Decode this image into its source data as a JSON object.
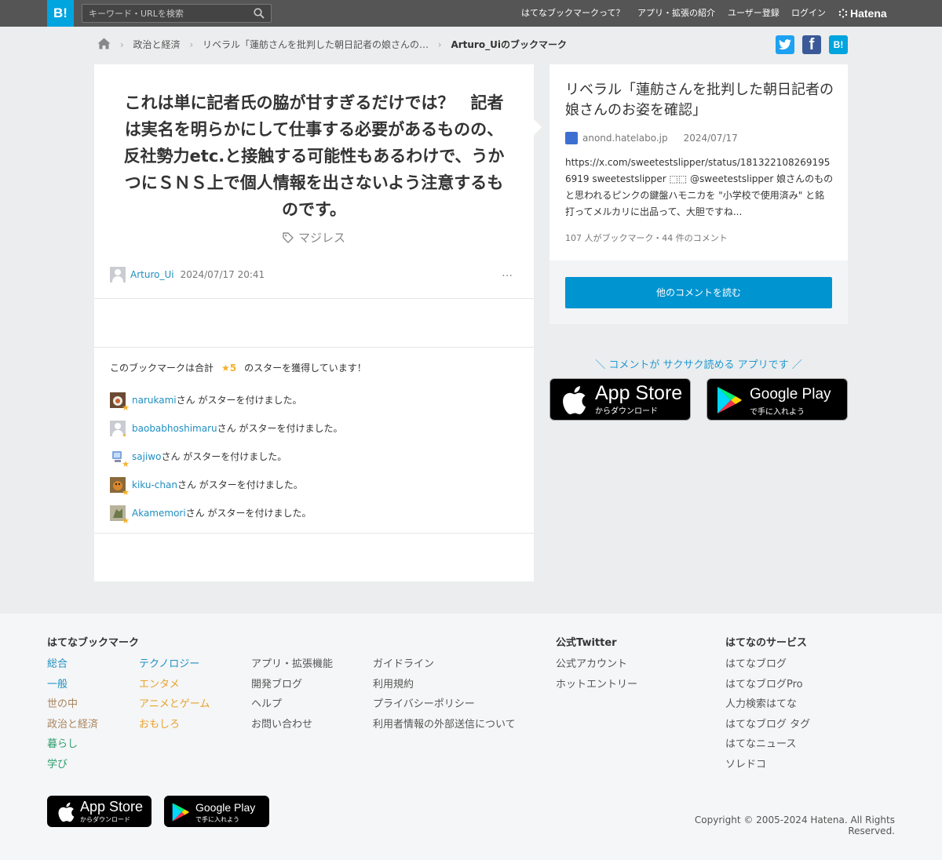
{
  "header": {
    "logo": "B!",
    "search_placeholder": "キーワード・URLを検索",
    "nav": [
      "はてなブックマークって？",
      "アプリ・拡張の紹介",
      "ユーザー登録",
      "ログイン"
    ],
    "brand": "Hatena"
  },
  "breadcrumb": {
    "items": [
      "政治と経済",
      "リベラル「蓮舫さんを批判した朝日記者の娘さんの…"
    ],
    "current": "Arturo_Uiのブックマーク"
  },
  "share": {
    "facebook": "f",
    "hatena": "B!"
  },
  "bookmark": {
    "comment": "これは単に記者氏の脇が甘すぎるだけでは？　記者は実名を明らかにして仕事する必要があるものの、反社勢力etc.と接触する可能性もあるわけで、うかつにＳＮＳ上で個人情報を出さないよう注意するものです。",
    "tag": "マジレス",
    "user": "Arturo_Ui",
    "date": "2024/07/17 20:41",
    "more": "…"
  },
  "stars": {
    "title_before": "このブックマークは合計",
    "count": "★5",
    "title_after": "のスターを獲得しています！",
    "suffix": "さん がスターを付けました。",
    "users": [
      "narukami",
      "baobabhoshimaru",
      "sajiwo",
      "kiku-chan",
      "Akamemori"
    ]
  },
  "entry": {
    "title": "リベラル「蓮舫さんを批判した朝日記者の娘さんのお姿を確認」",
    "site": "anond.hatelabo.jp",
    "date": "2024/07/17",
    "summary": "https://x.com/sweetestslipper/status/1813221082691956919 sweetestslipper ⬚⬚ @sweetestslipper 娘さんのものと思われるピンクの鍵盤ハモニカを \"小学校で使用済み\" と銘打ってメルカリに出品って、大胆ですね...",
    "meta": "107 人がブックマーク・44 件のコメント",
    "more_button": "他のコメントを読む"
  },
  "app_promo": {
    "text": "＼ コメントが サクサク読める アプリです ／",
    "appstore_big": "App Store",
    "appstore_small": "からダウンロード",
    "googleplay_big": "Google Play",
    "googleplay_small": "で手に入れよう"
  },
  "footer": {
    "col1_title": "はてなブックマーク",
    "cat_a": [
      "総合",
      "一般",
      "世の中",
      "政治と経済",
      "暮らし",
      "学び"
    ],
    "cat_b": [
      "テクノロジー",
      "エンタメ",
      "アニメとゲーム",
      "おもしろ"
    ],
    "links_a": [
      "アプリ・拡張機能",
      "開発ブログ",
      "ヘルプ",
      "お問い合わせ"
    ],
    "links_b": [
      "ガイドライン",
      "利用規約",
      "プライバシーポリシー",
      "利用者情報の外部送信について"
    ],
    "twitter_title": "公式Twitter",
    "twitter_links": [
      "公式アカウント",
      "ホットエントリー"
    ],
    "services_title": "はてなのサービス",
    "services": [
      "はてなブログ",
      "はてなブログPro",
      "人力検索はてな",
      "はてなブログ タグ",
      "はてなニュース",
      "ソレドコ"
    ],
    "copyright": "Copyright © 2005-2024 Hatena. All Rights Reserved."
  },
  "colors": {
    "brand_blue": "#00a4de",
    "link_blue": "#1f8fc2",
    "star": "#f4b128",
    "button": "#0094d1",
    "header_bg": "#555555",
    "twitter": "#1da1f2",
    "facebook": "#3b5998"
  }
}
